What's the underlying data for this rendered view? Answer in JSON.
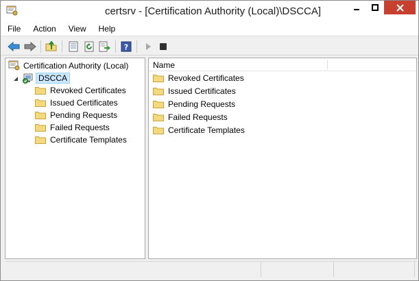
{
  "window": {
    "title": "certsrv - [Certification Authority (Local)\\DSCCA]"
  },
  "menu": {
    "items": [
      {
        "label": "File"
      },
      {
        "label": "Action"
      },
      {
        "label": "View"
      },
      {
        "label": "Help"
      }
    ]
  },
  "toolbar": {
    "buttons": [
      {
        "icon": "back-arrow-icon"
      },
      {
        "icon": "forward-arrow-icon"
      },
      {
        "icon": "up-folder-icon"
      },
      {
        "icon": "properties-icon"
      },
      {
        "icon": "refresh-icon"
      },
      {
        "icon": "export-list-icon"
      },
      {
        "icon": "help-icon"
      },
      {
        "icon": "start-service-icon"
      },
      {
        "icon": "stop-service-icon"
      }
    ]
  },
  "tree": {
    "root": "Certification Authority (Local)",
    "ca": "DSCCA",
    "children": [
      {
        "label": "Revoked Certificates"
      },
      {
        "label": "Issued Certificates"
      },
      {
        "label": "Pending Requests"
      },
      {
        "label": "Failed Requests"
      },
      {
        "label": "Certificate Templates"
      }
    ]
  },
  "list": {
    "column_name": "Name",
    "items": [
      {
        "label": "Revoked Certificates"
      },
      {
        "label": "Issued Certificates"
      },
      {
        "label": "Pending Requests"
      },
      {
        "label": "Failed Requests"
      },
      {
        "label": "Certificate Templates"
      }
    ]
  },
  "colors": {
    "close_button": "#c7402f",
    "selection": "#cce8ff",
    "folder": "#f5d97e"
  }
}
